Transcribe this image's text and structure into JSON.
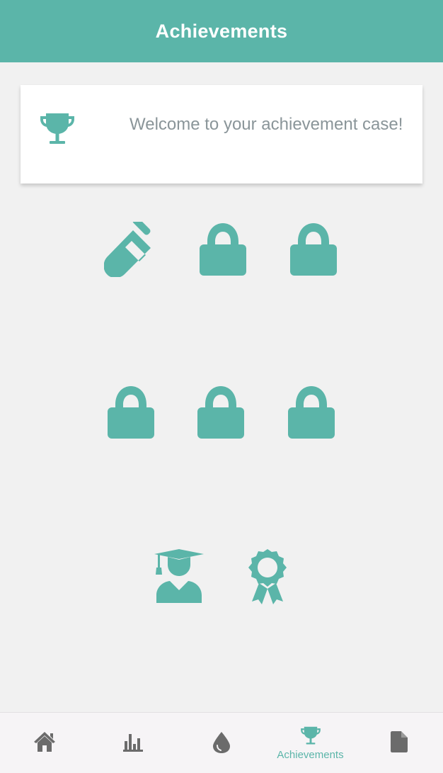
{
  "header": {
    "title": "Achievements"
  },
  "welcome": {
    "icon": "trophy-icon",
    "text": "Welcome to your achievement case!"
  },
  "badges": [
    {
      "icon": "test-tube-icon",
      "state": "unlocked"
    },
    {
      "icon": "lock-icon",
      "state": "locked"
    },
    {
      "icon": "lock-icon",
      "state": "locked"
    },
    {
      "icon": "lock-icon",
      "state": "locked"
    },
    {
      "icon": "lock-icon",
      "state": "locked"
    },
    {
      "icon": "lock-icon",
      "state": "locked"
    },
    {
      "icon": "graduate-icon",
      "state": "unlocked"
    },
    {
      "icon": "award-ribbon-icon",
      "state": "unlocked"
    }
  ],
  "tabbar": {
    "tabs": [
      {
        "icon": "home-icon",
        "label": ""
      },
      {
        "icon": "bar-chart-icon",
        "label": ""
      },
      {
        "icon": "droplet-icon",
        "label": ""
      },
      {
        "icon": "trophy-icon",
        "label": "Achievements",
        "active": true
      },
      {
        "icon": "document-icon",
        "label": ""
      }
    ]
  },
  "colors": {
    "accent": "#5bb5a9",
    "background": "#f1f1f1",
    "card": "#ffffff",
    "muted_text": "#8a9599",
    "inactive_icon": "#6b6b6b"
  }
}
